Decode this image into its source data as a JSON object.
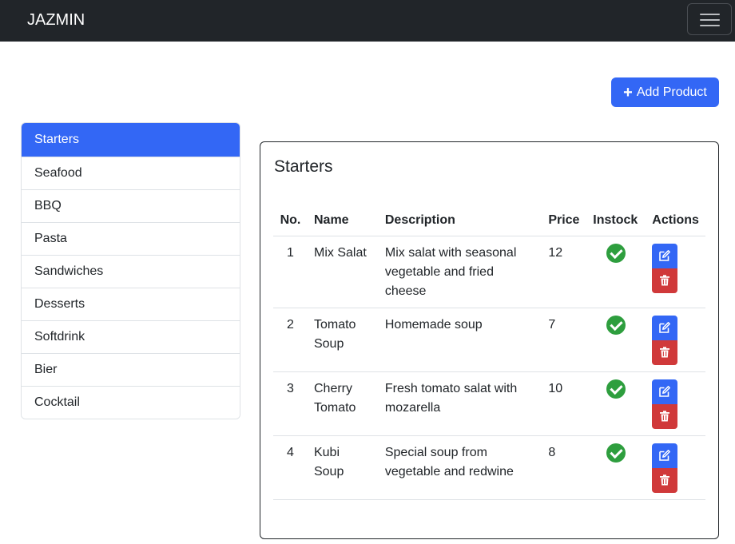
{
  "navbar": {
    "brand": "JAZMIN"
  },
  "toolbar": {
    "add_label": "Add Product"
  },
  "categories": [
    {
      "label": "Starters",
      "active": true
    },
    {
      "label": "Seafood"
    },
    {
      "label": "BBQ"
    },
    {
      "label": "Pasta"
    },
    {
      "label": "Sandwiches"
    },
    {
      "label": "Desserts"
    },
    {
      "label": "Softdrink"
    },
    {
      "label": "Bier"
    },
    {
      "label": "Cocktail"
    }
  ],
  "panel": {
    "title": "Starters",
    "columns": [
      "No.",
      "Name",
      "Description",
      "Price",
      "Instock",
      "Actions"
    ],
    "rows": [
      {
        "no": "1",
        "name": "Mix Salat",
        "description": "Mix salat with seasonal vegetable and fried cheese",
        "price": "12",
        "instock": true
      },
      {
        "no": "2",
        "name": "Tomato Soup",
        "description": "Homemade soup",
        "price": "7",
        "instock": true
      },
      {
        "no": "3",
        "name": "Cherry Tomato",
        "description": "Fresh tomato salat with mozarella",
        "price": "10",
        "instock": true
      },
      {
        "no": "4",
        "name": "Kubi Soup",
        "description": "Special soup from vegetable and redwine",
        "price": "8",
        "instock": true
      }
    ]
  },
  "colors": {
    "navbar": "#212529",
    "primary": "#3367f5",
    "success": "#2e9e3e",
    "danger": "#d0393a"
  }
}
